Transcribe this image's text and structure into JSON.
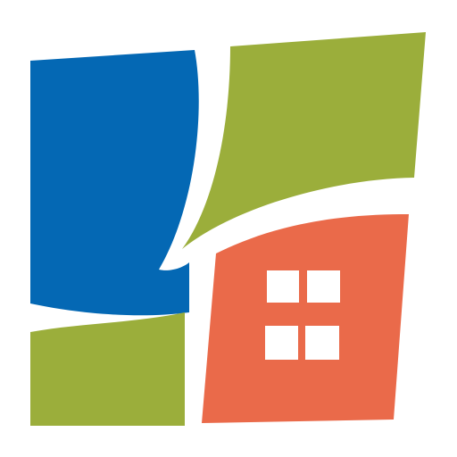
{
  "logo": {
    "name": "house-windows-logo",
    "colors": {
      "background": "#ffffff",
      "blue": "#0468b4",
      "green": "#9bae3b",
      "orange": "#ea6a4a",
      "window": "#ffffff"
    }
  }
}
